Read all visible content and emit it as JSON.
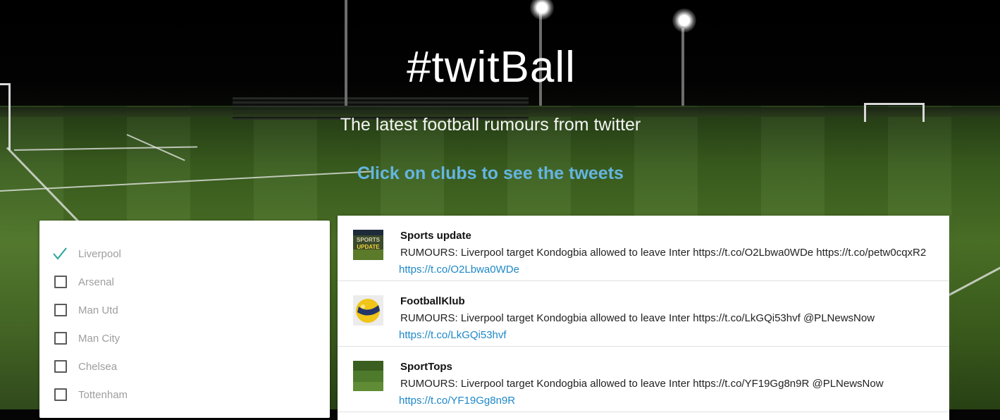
{
  "header": {
    "title": "#twitBall",
    "subtitle": "The latest football rumours from twitter",
    "cta": "Click on clubs to see the tweets"
  },
  "clubs": [
    {
      "label": "Liverpool",
      "checked": true
    },
    {
      "label": "Arsenal",
      "checked": false
    },
    {
      "label": "Man Utd",
      "checked": false
    },
    {
      "label": "Man City",
      "checked": false
    },
    {
      "label": "Chelsea",
      "checked": false
    },
    {
      "label": "Tottenham",
      "checked": false
    }
  ],
  "tweets": [
    {
      "name": "Sports update",
      "text": "RUMOURS: Liverpool target Kondogbia allowed to leave Inter https://t.co/O2Lbwa0WDe https://t.co/petw0cqxR2",
      "link": "https://t.co/O2Lbwa0WDe",
      "avatar_text": [
        "SPORTS",
        "UPDATE"
      ]
    },
    {
      "name": "FootballKlub",
      "text": "RUMOURS: Liverpool target Kondogbia allowed to leave Inter https://t.co/LkGQi53hvf @PLNewsNow",
      "link": "https://t.co/LkGQi53hvf"
    },
    {
      "name": "SportTops",
      "text": "RUMOURS: Liverpool target Kondogbia allowed to leave Inter https://t.co/YF19Gg8n9R @PLNewsNow",
      "link": "https://t.co/YF19Gg8n9R"
    }
  ],
  "colors": {
    "accent": "#26a69a",
    "cta": "#64b5e0",
    "link": "#1e88c8"
  }
}
